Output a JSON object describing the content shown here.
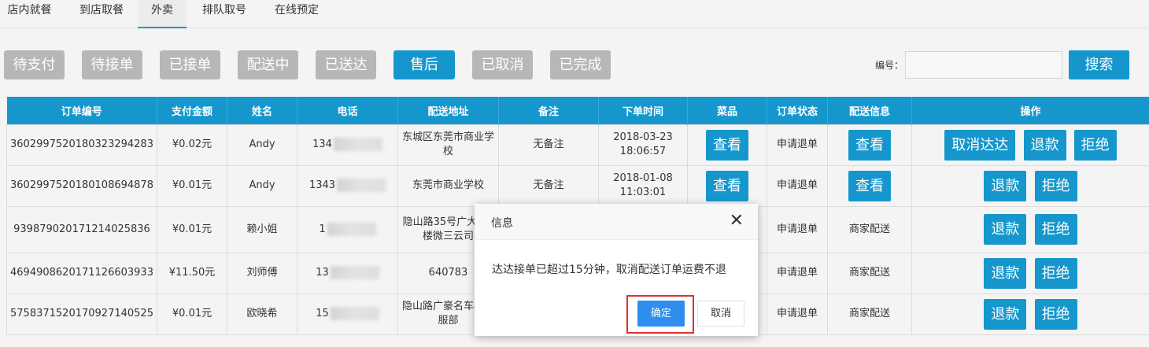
{
  "tabs": [
    "店内就餐",
    "到店取餐",
    "外卖",
    "排队取号",
    "在线预定"
  ],
  "filters": [
    "待支付",
    "待接单",
    "已接单",
    "配送中",
    "已送达",
    "售后",
    "已取消",
    "已完成"
  ],
  "search": {
    "label": "编号：",
    "value": "",
    "button": "搜索"
  },
  "table": {
    "headers": [
      "订单编号",
      "支付金额",
      "姓名",
      "电话",
      "配送地址",
      "备注",
      "下单时间",
      "菜品",
      "订单状态",
      "配送信息",
      "操作"
    ],
    "rows": [
      {
        "id": "3602997520180323294283",
        "amount": "¥0.02元",
        "name": "Andy",
        "phone": "134",
        "address": "东城区东莞市商业学校",
        "note": "无备注",
        "time": "2018-03-23 18:06:57",
        "dish": "查看",
        "status": "申请退单",
        "delivery": "查看",
        "actions": [
          "取消达达",
          "退款",
          "拒绝"
        ]
      },
      {
        "id": "3602997520180108694878",
        "amount": "¥0.01元",
        "name": "Andy",
        "phone": "1343",
        "address": "东莞市商业学校",
        "note": "无备注",
        "time": "2018-01-08 11:03:01",
        "dish": "查看",
        "status": "申请退单",
        "delivery": "查看",
        "actions": [
          "退款",
          "拒绝"
        ]
      },
      {
        "id": "9398790201712140258​36",
        "amount": "¥0.01元",
        "name": "赖小姐",
        "phone": "1",
        "address": "隐山路35号广大厦4楼微三云司",
        "note": "",
        "time": "",
        "dish": "",
        "status": "申请退单",
        "delivery": "商家配送",
        "actions": [
          "退款",
          "拒绝"
        ]
      },
      {
        "id": "4694908620171126603933",
        "amount": "¥11.50元",
        "name": "刘师傅",
        "phone": "13",
        "address": "640783",
        "note": "",
        "time": "",
        "dish": "",
        "status": "申请退单",
        "delivery": "商家配送",
        "actions": [
          "退款",
          "拒绝"
        ]
      },
      {
        "id": "5758371520170927140525",
        "amount": "¥0.01元",
        "name": "欧晓希",
        "phone": "15",
        "address": "隐山路广豪名车楼客服部",
        "note": "",
        "time": "",
        "dish": "",
        "status": "申请退单",
        "delivery": "商家配送",
        "actions": [
          "退款",
          "拒绝"
        ]
      }
    ]
  },
  "dialog": {
    "title": "信息",
    "close_icon": "close-icon",
    "message": "达达接单已超过15分钟，取消配送订单运费不退",
    "ok": "确定",
    "cancel": "取消"
  }
}
